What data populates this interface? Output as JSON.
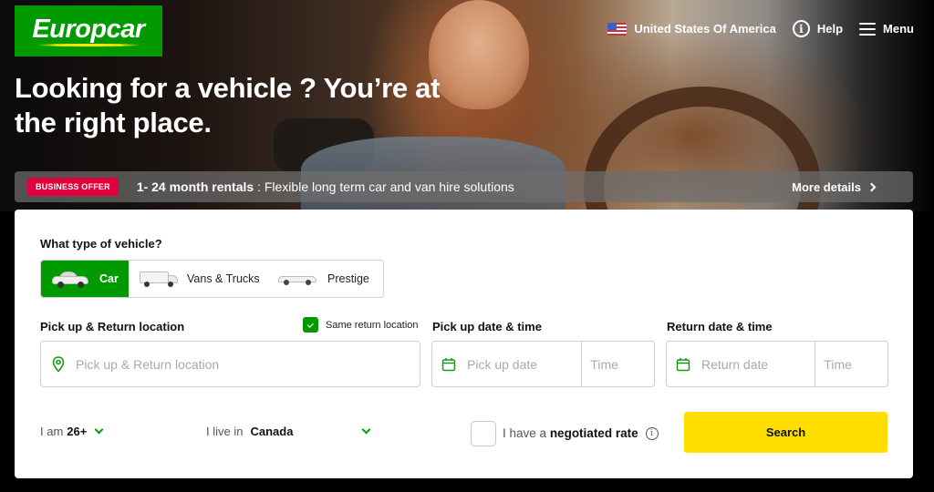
{
  "brand": {
    "name": "Europcar",
    "color": "#009900",
    "swoosh_color": "#ffe600"
  },
  "topnav": {
    "country": {
      "label": "United States Of America",
      "icon": "us-flag-icon"
    },
    "help": {
      "label": "Help",
      "icon": "info-icon"
    },
    "menu": {
      "label": "Menu",
      "icon": "hamburger-icon"
    }
  },
  "hero": {
    "headline": "Looking for a vehicle ? You’re at the right place."
  },
  "offer": {
    "badge": "BUSINESS OFFER",
    "badge_color": "#e2003c",
    "title": "1- 24 month rentals",
    "separator": " : ",
    "description": "Flexible long term car and van hire solutions",
    "more_label": "More details"
  },
  "booking": {
    "vehicle_type_label": "What type of vehicle?",
    "vehicle_types": [
      {
        "label": "Car",
        "icon": "car-icon",
        "selected": true
      },
      {
        "label": "Vans & Trucks",
        "icon": "van-icon",
        "selected": false
      },
      {
        "label": "Prestige",
        "icon": "convertible-icon",
        "selected": false
      }
    ],
    "location": {
      "label": "Pick up & Return location",
      "placeholder": "Pick up & Return location",
      "value": "",
      "same_return_label": "Same return location",
      "same_return_checked": true
    },
    "pickup": {
      "label": "Pick up date & time",
      "date_placeholder": "Pick up date",
      "time_placeholder": "Time"
    },
    "return": {
      "label": "Return date & time",
      "date_placeholder": "Return date",
      "time_placeholder": "Time"
    },
    "age": {
      "prefix": "I am",
      "value": "26+"
    },
    "residence": {
      "prefix": "I live in",
      "value": "Canada"
    },
    "negotiated": {
      "prefix": "I have a",
      "bold": "negotiated rate",
      "checked": false
    },
    "search_label": "Search",
    "search_color": "#ffdf00"
  }
}
